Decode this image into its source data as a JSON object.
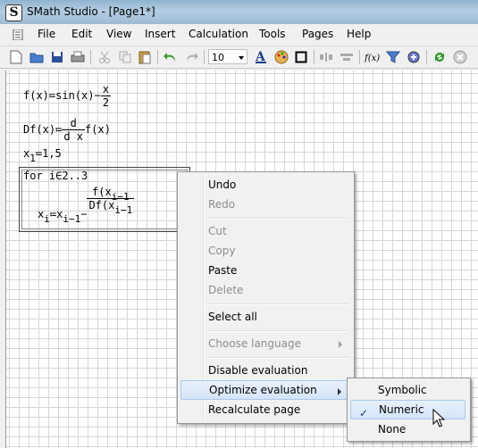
{
  "window": {
    "title": "SMath Studio - [Page1*]",
    "logo_letter": "S"
  },
  "menubar": [
    "File",
    "Edit",
    "View",
    "Insert",
    "Calculation",
    "Tools",
    "Pages",
    "Help"
  ],
  "toolbar": {
    "font_size": "10"
  },
  "worksheet": {
    "f_def": {
      "lhs": "f(x)",
      "assign": "≔",
      "rhs": "sin(x)−",
      "num": "x",
      "den": "2"
    },
    "df_def": {
      "lhs": "Df(x)",
      "assign": "≔",
      "num": "d",
      "den": "d x",
      "rhs": "f(x)"
    },
    "x1_def": {
      "base": "x",
      "sub": "1",
      "assign": "≔",
      "value": "1,5"
    },
    "loop": {
      "header": "for i∈2..3",
      "lhs_base": "x",
      "lhs_sub": "i",
      "rhs_base": "x",
      "rhs_sub": "i−1",
      "num_text": "f(x",
      "num_sub": "i−1",
      "den_text": "Df(x",
      "den_sub": "i−1"
    }
  },
  "context_menu": {
    "items": [
      {
        "label": "Undo",
        "enabled": true
      },
      {
        "label": "Redo",
        "enabled": false
      },
      {
        "label": "Cut",
        "enabled": false
      },
      {
        "label": "Copy",
        "enabled": false
      },
      {
        "label": "Paste",
        "enabled": true
      },
      {
        "label": "Delete",
        "enabled": false
      },
      {
        "label": "Select all",
        "enabled": true
      },
      {
        "label": "Choose language",
        "enabled": false,
        "submenu": true
      },
      {
        "label": "Disable evaluation",
        "enabled": true
      },
      {
        "label": "Optimize evaluation",
        "enabled": true,
        "submenu": true,
        "highlighted": true
      },
      {
        "label": "Recalculate page",
        "enabled": true
      }
    ]
  },
  "submenu": {
    "items": [
      {
        "label": "Symbolic",
        "checked": false
      },
      {
        "label": "Numeric",
        "checked": true,
        "highlighted": true
      },
      {
        "label": "None",
        "checked": false
      }
    ]
  },
  "colors": {
    "highlight": "#d4e5f8",
    "disabled_text": "#8d8d8d",
    "grid": "#d6d6d6"
  }
}
